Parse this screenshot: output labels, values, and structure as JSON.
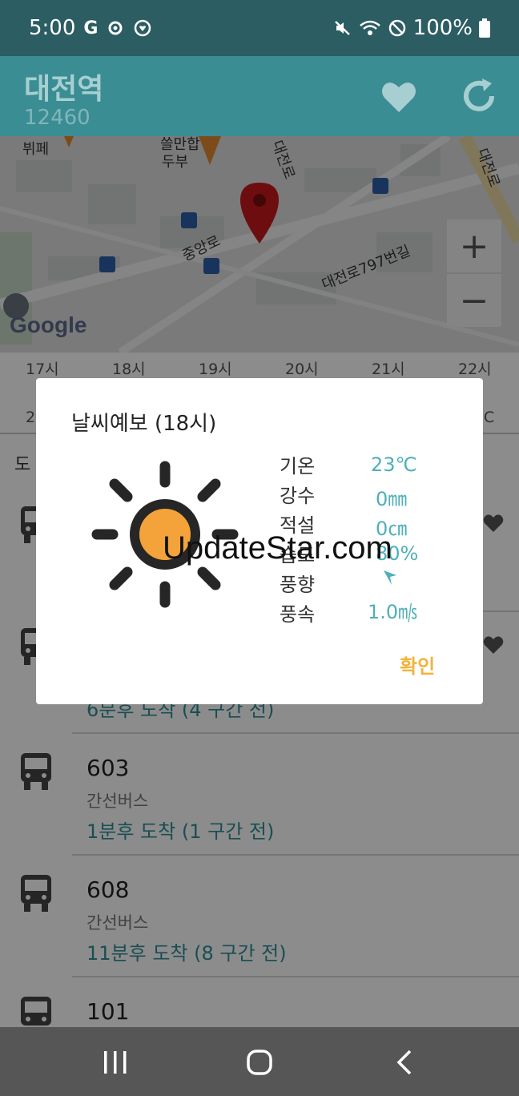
{
  "status_bar": {
    "time": "5:00",
    "icon_g": "G",
    "battery": "100%"
  },
  "app_bar": {
    "station_name": "대전역",
    "station_id": "12460"
  },
  "map": {
    "labels": [
      "뷔페",
      "쓸만합",
      "두부",
      "대전로",
      "대전로",
      "중앙로",
      "대전로797번길"
    ],
    "zoom_in": "+",
    "zoom_out": "−",
    "google": "Google"
  },
  "hours": {
    "labels": [
      "17시",
      "18시",
      "19시",
      "20시",
      "21시",
      "22시"
    ],
    "partial_left": "2",
    "partial_right": "C"
  },
  "list": {
    "section_label": "도",
    "items": [
      {
        "route": "",
        "type": "",
        "arrival": ""
      },
      {
        "route": "",
        "type": "",
        "arrival": "6분후 도착 (4 구간 전)"
      },
      {
        "route": "603",
        "type": "간선버스",
        "arrival": "1분후 도착 (1 구간 전)"
      },
      {
        "route": "608",
        "type": "간선버스",
        "arrival": "11분후 도착 (8 구간 전)"
      },
      {
        "route": "101",
        "type": "",
        "arrival": ""
      }
    ]
  },
  "dialog": {
    "title": "날씨예보 (18시)",
    "rows": [
      {
        "label": "기온",
        "value": "23℃"
      },
      {
        "label": "강수",
        "value": "0㎜"
      },
      {
        "label": "적설",
        "value": "0㎝"
      },
      {
        "label": "습도",
        "value": "80%"
      },
      {
        "label": "풍향",
        "value": ""
      },
      {
        "label": "풍속",
        "value": "1.0㎧"
      }
    ],
    "confirm": "확인",
    "watermark": "UpdateStar.com"
  },
  "colors": {
    "status_bar": "#2b5d63",
    "app_bar": "#3a8d93",
    "accent_teal": "#4eb0b8",
    "accent_yellow": "#f2b33b",
    "sun_orange": "#f4a23a"
  }
}
